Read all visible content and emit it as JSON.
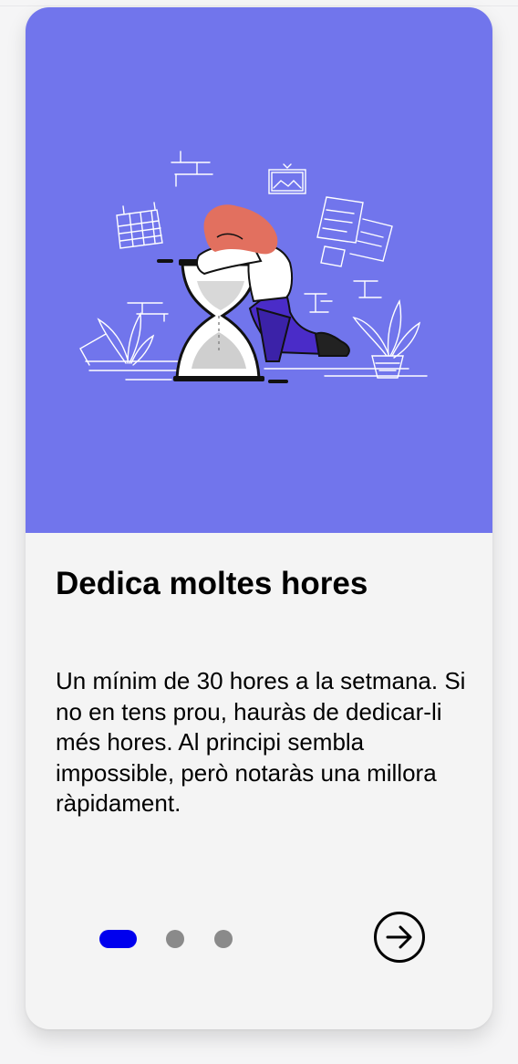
{
  "slide": {
    "title": "Dedica moltes hores",
    "description": "Un mínim de 30 hores a la setmana. Si no en tens prou, hauràs de dedicar-li més hores. Al principi sembla impossible, però notaràs una millora ràpidament.",
    "illustration": "woman-leaning-on-hourglass-illustration"
  },
  "pagination": {
    "total": 3,
    "current": 1,
    "next_icon": "arrow-right-circle-icon"
  },
  "colors": {
    "hero_background": "#7175ec",
    "card_background": "#f4f4f4",
    "active_dot": "#0000ee",
    "inactive_dot": "#8a8a8a",
    "hair": "#e2705f",
    "pants": "#4a2cc8"
  }
}
